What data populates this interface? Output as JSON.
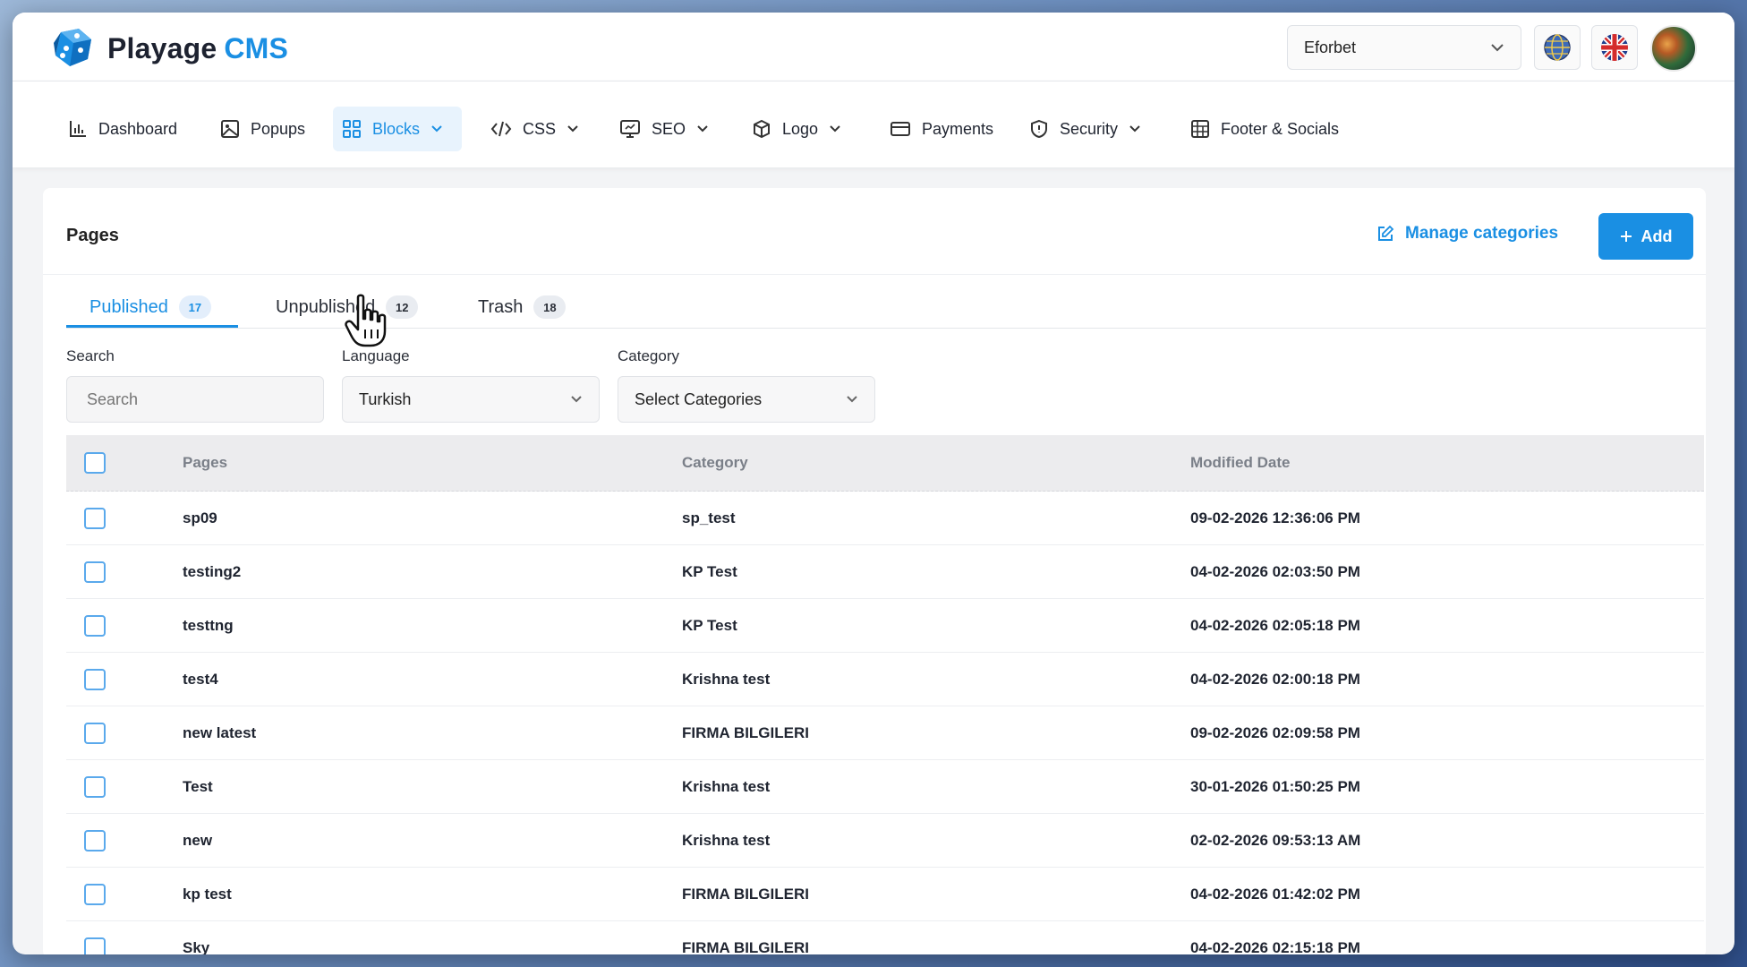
{
  "app": {
    "logo_text": "Playage",
    "logo_accent": "CMS",
    "brand_color": "#1a8fe3"
  },
  "topbar": {
    "site_select_value": "Eforbet",
    "globe_icon": "globe-icon",
    "flag_icon": "uk-flag-icon",
    "avatar": "user-avatar"
  },
  "nav": {
    "items": [
      {
        "label": "Dashboard",
        "icon": "bar-chart-icon",
        "dropdown": false
      },
      {
        "label": "Popups",
        "icon": "image-icon",
        "dropdown": false
      },
      {
        "label": "Blocks",
        "icon": "grid-icon",
        "dropdown": true,
        "active": true
      },
      {
        "label": "CSS",
        "icon": "code-icon",
        "dropdown": true
      },
      {
        "label": "SEO",
        "icon": "monitor-icon",
        "dropdown": true
      },
      {
        "label": "Logo",
        "icon": "box-icon",
        "dropdown": true
      },
      {
        "label": "Payments",
        "icon": "credit-card-icon",
        "dropdown": false
      },
      {
        "label": "Security",
        "icon": "shield-icon",
        "dropdown": true
      },
      {
        "label": "Footer & Socials",
        "icon": "layout-icon",
        "dropdown": false
      }
    ]
  },
  "pages": {
    "title": "Pages",
    "manage_categories": "Manage categories",
    "add_label": "Add",
    "tabs": [
      {
        "label": "Published",
        "count": "17",
        "active": true
      },
      {
        "label": "Unpublished",
        "count": "12"
      },
      {
        "label": "Trash",
        "count": "18"
      }
    ],
    "filters": {
      "search_label": "Search",
      "search_placeholder": "Search",
      "language_label": "Language",
      "language_value": "Turkish",
      "category_label": "Category",
      "category_value": "Select Categories"
    },
    "table": {
      "columns": [
        "Pages",
        "Category",
        "Modified Date"
      ],
      "rows": [
        {
          "page": "sp09",
          "category": "sp_test",
          "date": "09-02-2026 12:36:06 PM"
        },
        {
          "page": "testing2",
          "category": "KP Test",
          "date": "04-02-2026 02:03:50 PM"
        },
        {
          "page": "testtng",
          "category": "KP Test",
          "date": "04-02-2026 02:05:18 PM"
        },
        {
          "page": "test4",
          "category": "Krishna test",
          "date": "04-02-2026 02:00:18 PM"
        },
        {
          "page": "new latest",
          "category": "FIRMA BILGILERI",
          "date": "09-02-2026 02:09:58 PM"
        },
        {
          "page": "Test",
          "category": "Krishna test",
          "date": "30-01-2026 01:50:25 PM"
        },
        {
          "page": "new",
          "category": "Krishna test",
          "date": "02-02-2026 09:53:13 AM"
        },
        {
          "page": "kp test",
          "category": "FIRMA BILGILERI",
          "date": "04-02-2026 01:42:02 PM"
        },
        {
          "page": "Sky",
          "category": "FIRMA BILGILERI",
          "date": "04-02-2026 02:15:18 PM"
        }
      ]
    }
  }
}
